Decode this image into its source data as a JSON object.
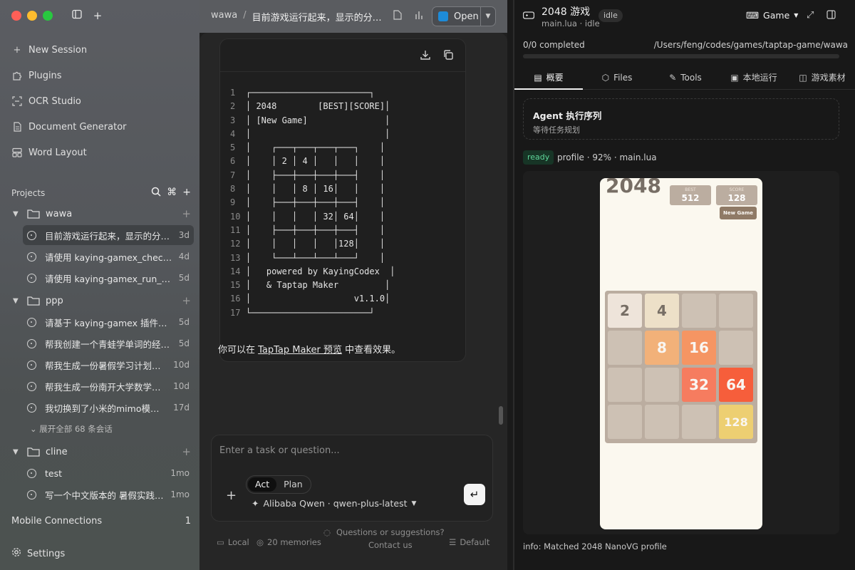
{
  "sidebar": {
    "nav": [
      {
        "label": "New Session",
        "icon": "plus-icon"
      },
      {
        "label": "Plugins",
        "icon": "puzzle-icon"
      },
      {
        "label": "OCR Studio",
        "icon": "scan-icon"
      },
      {
        "label": "Document Generator",
        "icon": "document-icon"
      },
      {
        "label": "Word Layout",
        "icon": "layout-icon"
      }
    ],
    "projects_label": "Projects",
    "projects": [
      {
        "name": "wawa",
        "sessions": [
          {
            "title": "目前游戏运行起来，显示的分…",
            "age": "3d",
            "active": true
          },
          {
            "title": "请使用 kaying-gamex_check_…",
            "age": "4d"
          },
          {
            "title": "请使用 kaying-gamex_run_pr…",
            "age": "5d"
          }
        ]
      },
      {
        "name": "ppp",
        "sessions": [
          {
            "title": "请基于 kaying-gamex 插件，…",
            "age": "5d"
          },
          {
            "title": "帮我创建一个青蛙学单词的经…",
            "age": "5d"
          },
          {
            "title": "帮我生成一份暑假学习计划，…",
            "age": "10d"
          },
          {
            "title": "帮我生成一份南开大学数学系…",
            "age": "10d"
          },
          {
            "title": "我切换到了小米的mimo模型…",
            "age": "17d"
          }
        ],
        "expand_label": "展开全部 68 条会话"
      },
      {
        "name": "cline",
        "sessions": [
          {
            "title": "test",
            "age": "1mo"
          },
          {
            "title": "写一个中文版本的 暑假实践…",
            "age": "1mo"
          }
        ]
      }
    ],
    "mobile_label": "Mobile Connections",
    "mobile_count": "1",
    "settings_label": "Settings"
  },
  "center": {
    "breadcrumb_project": "wawa",
    "breadcrumb_sep": "/",
    "breadcrumb_session": "目前游戏运行起来，显示的分…",
    "open_label": "Open",
    "code_lines": [
      "┌───────────────────────┐",
      "│ 2048        [BEST][SCORE]│",
      "│ [New Game]               │",
      "│                          │",
      "│    ┌───┬───┬───┬───┐    │",
      "│    │ 2 │ 4 │   │   │    │",
      "│    ├───┼───┼───┼───┤    │",
      "│    │   │ 8 │ 16│   │    │",
      "│    ├───┼───┼───┼───┤    │",
      "│    │   │   │ 32│ 64│    │",
      "│    ├───┼───┼───┼───┤    │",
      "│    │   │   │   │128│    │",
      "│    └───┴───┴───┴───┘    │",
      "│   powered by KayingCodex  │",
      "│   & Taptap Maker         │",
      "│                    v1.1.0│",
      "└───────────────────────┘"
    ],
    "answer_prefix": "你可以在 ",
    "answer_link": "TapTap Maker 预览",
    "answer_suffix": " 中查看效果。",
    "input_placeholder": "Enter a task or question...",
    "mode_act": "Act",
    "mode_plan": "Plan",
    "model_label": "Alibaba Qwen · qwen-plus-latest",
    "footer_local": "Local",
    "footer_memories": "20 memories",
    "footer_feedback_1": "Questions or suggestions?",
    "footer_feedback_2": "Contact us",
    "footer_default": "Default"
  },
  "right": {
    "title": "2048 游戏",
    "subtitle": "main.lua · idle",
    "status_badge": "idle",
    "game_label": "Game",
    "progress_text": "0/0 completed",
    "progress_fraction": 0,
    "path": "/Users/feng/codes/games/taptap-game/wawa",
    "tabs": [
      {
        "label": "概要",
        "icon": "overview-icon",
        "active": true
      },
      {
        "label": "Files",
        "icon": "cube-icon"
      },
      {
        "label": "Tools",
        "icon": "wrench-icon"
      },
      {
        "label": "本地运行",
        "icon": "play-screen-icon"
      },
      {
        "label": "游戏素材",
        "icon": "image-icon"
      }
    ],
    "agent_title": "Agent 执行序列",
    "agent_sub": "等待任务规划",
    "ready_badge": "ready",
    "ready_text": "profile · 92% · main.lua",
    "info": "info: Matched 2048 NanoVG profile"
  },
  "game": {
    "title": "2048",
    "best_label": "BEST",
    "best_value": "512",
    "score_label": "SCORE",
    "score_value": "128",
    "new_game": "New Game",
    "grid": [
      [
        "2",
        "4",
        "",
        ""
      ],
      [
        "",
        "8",
        "16",
        ""
      ],
      [
        "",
        "",
        "32",
        "64"
      ],
      [
        "",
        "",
        "",
        "128"
      ]
    ],
    "tile_colors": {
      "2": [
        "#eee4da",
        "#776e65"
      ],
      "4": [
        "#ede0c8",
        "#776e65"
      ],
      "8": [
        "#f2b179",
        "#f9f6f2"
      ],
      "16": [
        "#f59563",
        "#f9f6f2"
      ],
      "32": [
        "#f67c5f",
        "#f9f6f2"
      ],
      "64": [
        "#f65e3b",
        "#f9f6f2"
      ],
      "128": [
        "#edcf72",
        "#f9f6f2"
      ]
    }
  }
}
